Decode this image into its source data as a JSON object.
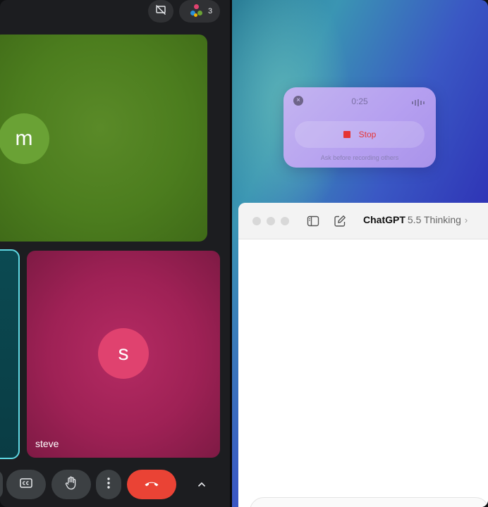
{
  "meet": {
    "participant_count": "3",
    "participants": [
      {
        "initial": "m"
      },
      {
        "initial": "s",
        "name": "steve"
      }
    ]
  },
  "icons": {
    "present": "no-present-icon",
    "people": "people-icon",
    "captions": "captions-icon",
    "hand": "raise-hand-icon",
    "more": "more-vert-icon",
    "end": "end-call-icon",
    "chevron": "chevron-up-icon",
    "close": "close-icon",
    "waveform": "waveform-icon",
    "stop": "stop-icon",
    "sidebar": "sidebar-toggle-icon",
    "compose": "compose-icon"
  },
  "recorder": {
    "close_label": "×",
    "timer": "0:25",
    "stop_label": "Stop",
    "note": "Ask before recording others"
  },
  "chatgpt": {
    "brand": "ChatGPT",
    "model": "5.5 Thinking",
    "chevron": "›"
  },
  "colors": {
    "meet_bg": "#1c1d20",
    "tile_m": "#4c7d1e",
    "avatar_m": "#6aa235",
    "tile_s": "#9e2155",
    "avatar_s": "#e0426f",
    "tile_cyan_border": "#5fd9e4",
    "end_call": "#ea4335",
    "stop_red": "#e53434",
    "recorder_bg": "#b59ff0"
  }
}
